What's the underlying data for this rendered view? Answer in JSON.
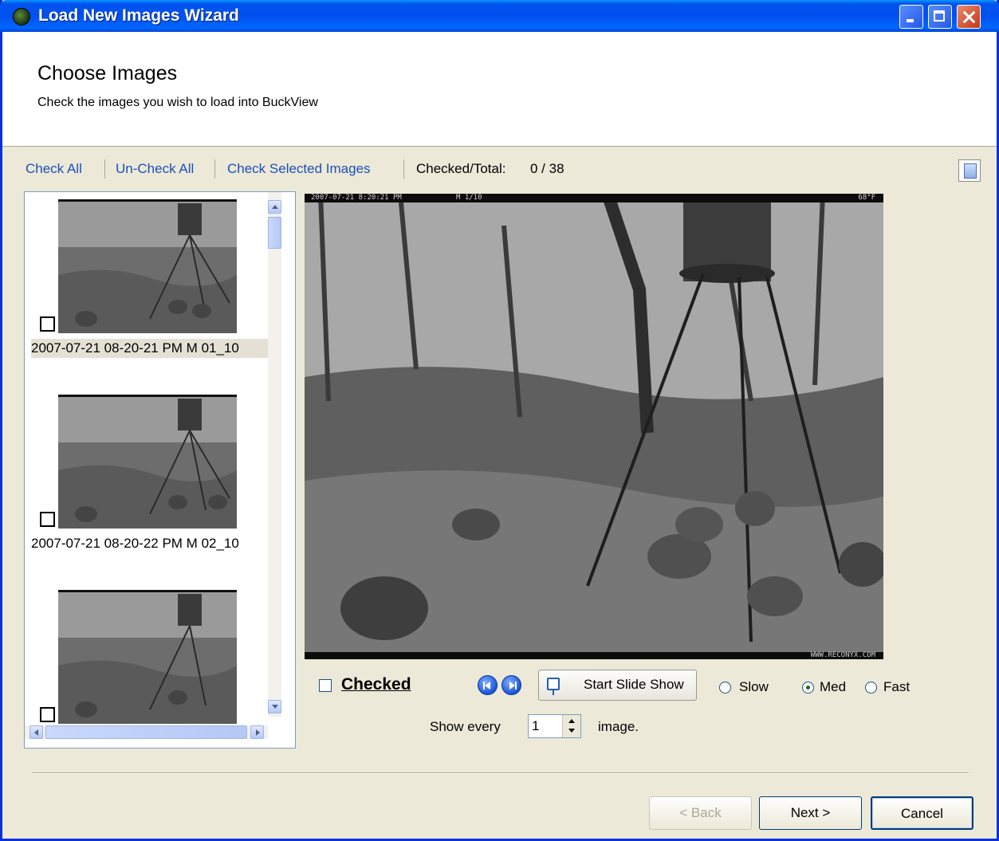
{
  "window": {
    "title": "Load New Images Wizard"
  },
  "header": {
    "title": "Choose Images",
    "subtitle": "Check the images you wish to load into BuckView"
  },
  "toolbar": {
    "check_all": "Check All",
    "uncheck_all": "Un-Check All",
    "check_selected": "Check Selected Images",
    "count_label": "Checked/Total:",
    "count_value": "0 / 38"
  },
  "thumbnails": [
    {
      "caption": "2007-07-21 08-20-21 PM M 01_10",
      "checked": false,
      "selected": true
    },
    {
      "caption": "2007-07-21 08-20-22 PM M 02_10",
      "checked": false,
      "selected": false
    },
    {
      "caption": "",
      "checked": false,
      "selected": false
    }
  ],
  "preview": {
    "stamp_date": "2007-07-21 8:20:21 PM",
    "stamp_frame": "M 1/10",
    "stamp_temp": "68°F",
    "stamp_site": "WWW.RECONYX.COM"
  },
  "controls": {
    "checked_label": "Checked",
    "checked": false,
    "slideshow_label": "Start Slide Show",
    "speeds": [
      {
        "label": "Slow",
        "selected": false
      },
      {
        "label": "Med",
        "selected": true
      },
      {
        "label": "Fast",
        "selected": false
      }
    ],
    "show_every_label": "Show every",
    "show_every_value": "1",
    "show_every_suffix": "image."
  },
  "buttons": {
    "back": "< Back",
    "next": "Next >",
    "cancel": "Cancel"
  }
}
